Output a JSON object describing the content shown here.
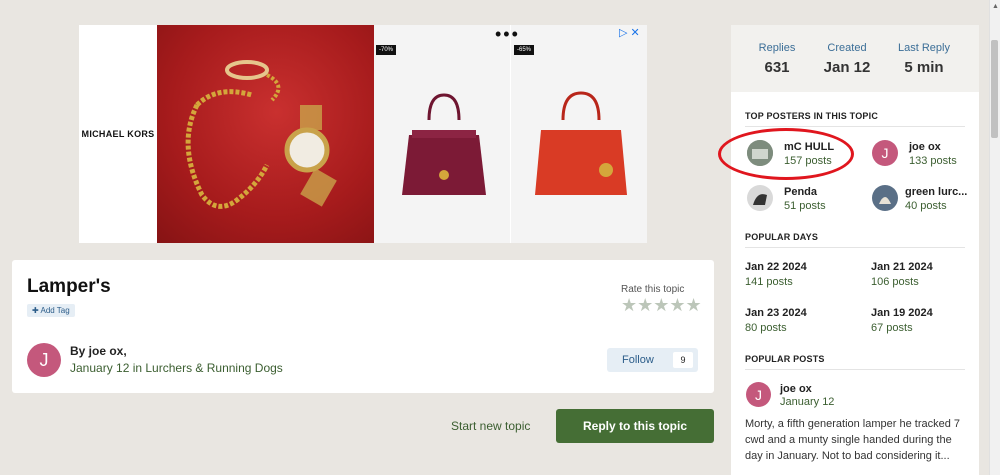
{
  "ad": {
    "brand": "MICHAEL KORS",
    "tag1": "-70%",
    "tag2": "-65%",
    "dots": "•••"
  },
  "topic": {
    "title": "Lamper's",
    "add_tag": "✚ Add Tag",
    "rate_label": "Rate this topic",
    "stars": "★★★★★",
    "author_initial": "J",
    "by_line": "By joe ox,",
    "date_line": "January 12 in Lurchers & Running Dogs",
    "follow_label": "Follow",
    "follow_count": "9"
  },
  "actions": {
    "start_topic": "Start new topic",
    "reply": "Reply to this topic"
  },
  "stats": [
    {
      "label": "Replies",
      "value": "631"
    },
    {
      "label": "Created",
      "value": "Jan 12"
    },
    {
      "label": "Last Reply",
      "value": "5 min"
    }
  ],
  "top_posters": {
    "heading": "TOP POSTERS IN THIS TOPIC",
    "items": [
      {
        "name": "mC HULL",
        "count": "157 posts"
      },
      {
        "name": "joe ox",
        "count": "133 posts",
        "initial": "J"
      },
      {
        "name": "Penda",
        "count": "51 posts"
      },
      {
        "name": "green lurc...",
        "count": "40 posts"
      }
    ]
  },
  "popular_days": {
    "heading": "POPULAR DAYS",
    "items": [
      {
        "date": "Jan 22 2024",
        "count": "141 posts"
      },
      {
        "date": "Jan 21 2024",
        "count": "106 posts"
      },
      {
        "date": "Jan 23 2024",
        "count": "80 posts"
      },
      {
        "date": "Jan 19 2024",
        "count": "67 posts"
      }
    ]
  },
  "popular_posts": {
    "heading": "POPULAR POSTS",
    "author": "joe ox",
    "author_initial": "J",
    "date": "January 12",
    "text": "Morty, a fifth generation lamper he tracked 7 cwd and a munty single handed during the day in January. Not to bad considering it..."
  },
  "colors": {
    "accent_green": "#456e35",
    "link_green": "#3b5e30",
    "avatar_pink": "#c4587c",
    "annotation_red": "#e0161e"
  }
}
